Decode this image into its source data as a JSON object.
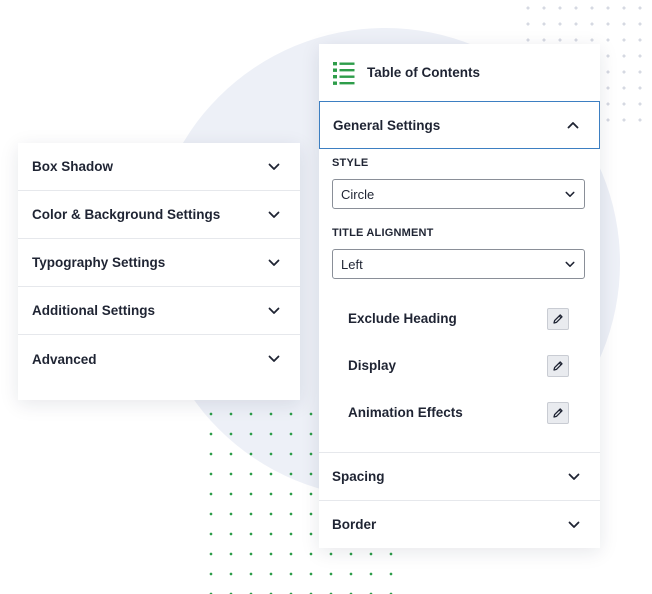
{
  "left_panel": {
    "items": [
      {
        "label": "Box Shadow"
      },
      {
        "label": "Color & Background Settings"
      },
      {
        "label": "Typography Settings"
      },
      {
        "label": "Additional Settings"
      },
      {
        "label": "Advanced"
      }
    ]
  },
  "right_panel": {
    "title": "Table of Contents",
    "title_icon": "list-icon",
    "accent_color": "#2e9d4a",
    "general": {
      "label": "General Settings",
      "style_label": "STYLE",
      "style_value": "Circle",
      "alignment_label": "TITLE ALIGNMENT",
      "alignment_value": "Left",
      "sub_items": [
        {
          "label": "Exclude Heading"
        },
        {
          "label": "Display"
        },
        {
          "label": "Animation Effects"
        }
      ]
    },
    "spacing_label": "Spacing",
    "border_label": "Border"
  }
}
